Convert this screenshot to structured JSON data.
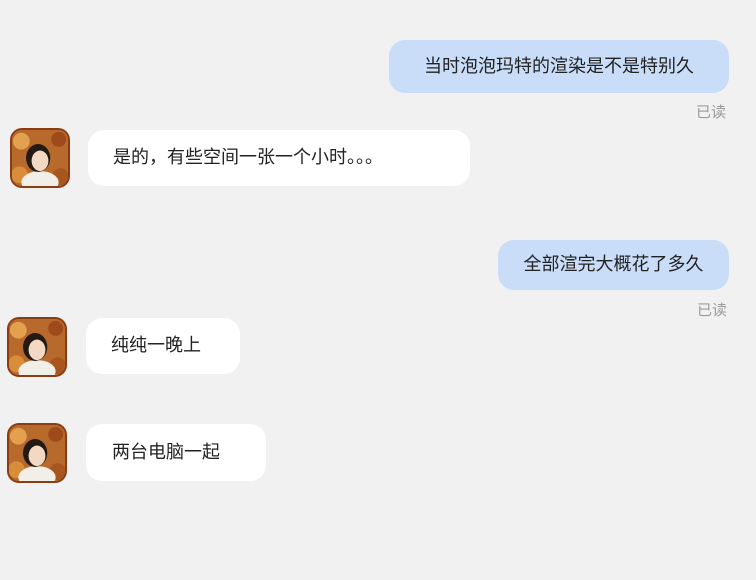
{
  "conversation": {
    "messages": [
      {
        "direction": "outgoing",
        "text": "当时泡泡玛特的渲染是不是特别久",
        "status": "已读"
      },
      {
        "direction": "incoming",
        "text": "是的，有些空间一张一个小时。。。"
      },
      {
        "direction": "outgoing",
        "text": "全部渲完大概花了多久",
        "status": "已读"
      },
      {
        "direction": "incoming",
        "text": "纯纯一晚上"
      },
      {
        "direction": "incoming",
        "text": "两台电脑一起"
      }
    ]
  },
  "icons": {
    "avatar": "user-avatar-photo"
  },
  "colors": {
    "background": "#f1f1f1",
    "outgoing_bubble": "#c9ddf8",
    "incoming_bubble": "#ffffff",
    "read_status": "#9a9a9a"
  }
}
